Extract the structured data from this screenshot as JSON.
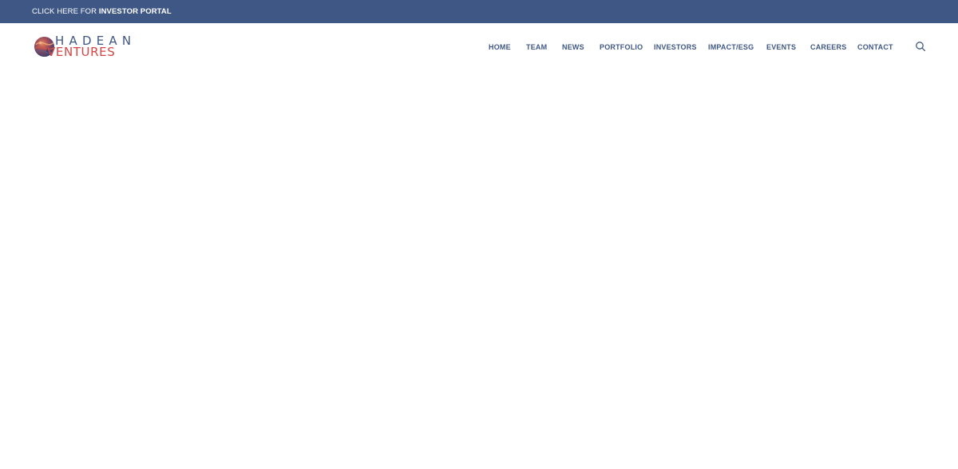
{
  "topbar": {
    "prefix": "CLICK HERE FOR ",
    "link_bold": "INVESTOR PORTAL",
    "background": "#3f5785"
  },
  "logo": {
    "line1": "HADEAN",
    "line2": "VENTURES",
    "line1_color": "#3f5785",
    "line2_color": "#d64545",
    "icon": "globe-logo-icon"
  },
  "nav": {
    "items": [
      {
        "label": "HOME"
      },
      {
        "label": "TEAM"
      },
      {
        "label": "NEWS"
      },
      {
        "label": "PORTFOLIO"
      },
      {
        "label": "INVESTORS"
      },
      {
        "label": "IMPACT/ESG"
      },
      {
        "label": "EVENTS"
      },
      {
        "label": "CAREERS"
      },
      {
        "label": "CONTACT"
      }
    ],
    "color": "#3f5785",
    "search_icon": "search-icon"
  }
}
